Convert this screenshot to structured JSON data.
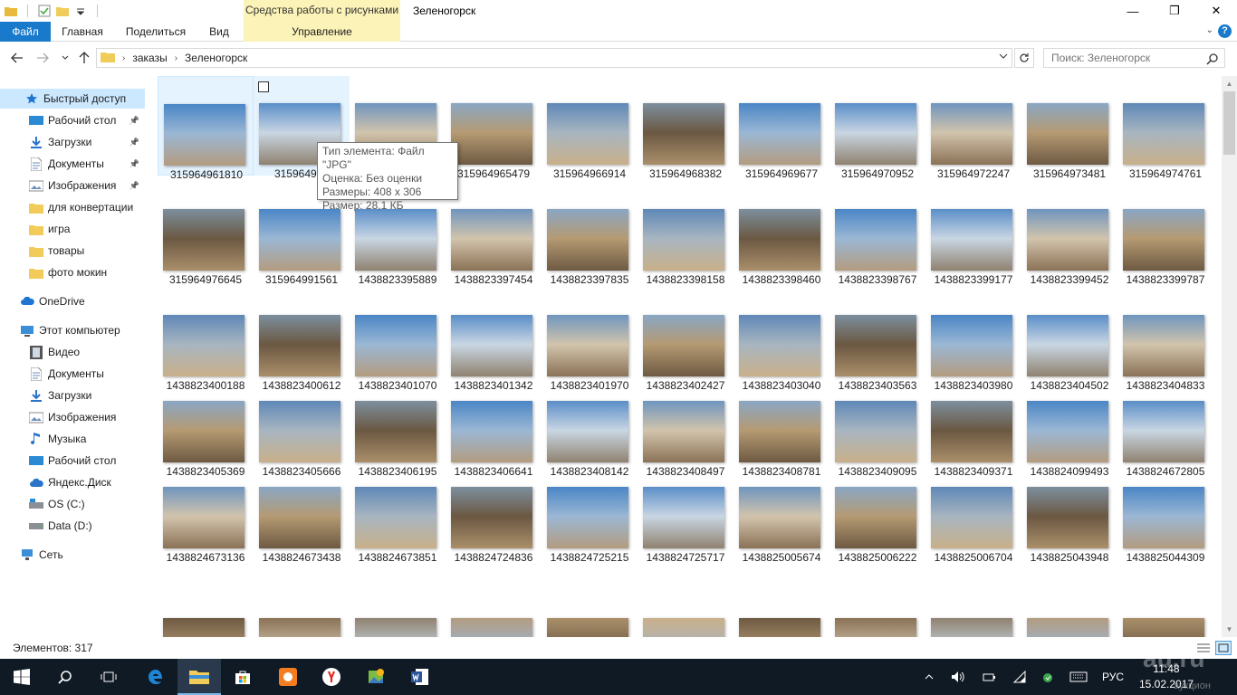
{
  "window": {
    "title": "Зеленогорск",
    "contextual_group": "Средства работы с рисунками",
    "minimize": "—",
    "maximize": "❐",
    "close": "✕"
  },
  "ribbon": {
    "tabs": [
      "Файл",
      "Главная",
      "Поделиться",
      "Вид"
    ],
    "contextual_tab": "Управление",
    "help": "?"
  },
  "address": {
    "crumbs": [
      "заказы",
      "Зеленогорск"
    ],
    "search_placeholder": "Поиск: Зеленогорск"
  },
  "nav": {
    "quick_access": "Быстрый доступ",
    "quick_items": [
      {
        "label": "Рабочий стол",
        "icon": "desktop-icon",
        "pinned": true
      },
      {
        "label": "Загрузки",
        "icon": "downloads-icon",
        "pinned": true
      },
      {
        "label": "Документы",
        "icon": "documents-icon",
        "pinned": true
      },
      {
        "label": "Изображения",
        "icon": "pictures-icon",
        "pinned": true
      },
      {
        "label": "для конвертации",
        "icon": "folder-icon",
        "pinned": false
      },
      {
        "label": "игра",
        "icon": "folder-icon",
        "pinned": false
      },
      {
        "label": "товары",
        "icon": "folder-icon",
        "pinned": false
      },
      {
        "label": "фото мокин",
        "icon": "folder-icon",
        "pinned": false
      }
    ],
    "onedrive": "OneDrive",
    "this_pc": "Этот компьютер",
    "pc_items": [
      {
        "label": "Видео",
        "icon": "video-icon"
      },
      {
        "label": "Документы",
        "icon": "documents-icon"
      },
      {
        "label": "Загрузки",
        "icon": "downloads-icon"
      },
      {
        "label": "Изображения",
        "icon": "pictures-icon"
      },
      {
        "label": "Музыка",
        "icon": "music-icon"
      },
      {
        "label": "Рабочий стол",
        "icon": "desktop-icon"
      },
      {
        "label": "Яндекс.Диск",
        "icon": "yandex-disk-icon"
      },
      {
        "label": "OS (C:)",
        "icon": "drive-c-icon"
      },
      {
        "label": "Data (D:)",
        "icon": "drive-d-icon"
      }
    ],
    "network": "Сеть"
  },
  "files": [
    "315964961810",
    "315964963",
    "315964965479_hidden",
    "315964965479",
    "315964966914",
    "315964968382",
    "315964969677",
    "315964970952",
    "315964972247",
    "315964973481",
    "315964974761",
    "315964976645",
    "315964991561",
    "1438823395889",
    "1438823397454",
    "1438823397835",
    "1438823398158",
    "1438823398460",
    "1438823398767",
    "1438823399177",
    "1438823399452",
    "1438823399787",
    "1438823400188",
    "1438823400612",
    "1438823401070",
    "1438823401342",
    "1438823401970",
    "1438823402427",
    "1438823403040",
    "1438823403563",
    "1438823403980",
    "1438823404502",
    "1438823404833",
    "1438823405369",
    "1438823405666",
    "1438823406195",
    "1438823406641",
    "1438823408142",
    "1438823408497",
    "1438823408781",
    "1438823409095",
    "1438823409371",
    "1438824099493",
    "1438824672805",
    "1438824673136",
    "1438824673438",
    "1438824673851",
    "1438824724836",
    "1438824725215",
    "1438824725717",
    "1438825005674",
    "1438825006222",
    "1438825006704",
    "1438825043948",
    "1438825044309"
  ],
  "tooltip": {
    "line1": "Тип элемента: Файл \"JPG\"",
    "line2": "Оценка: Без оценки",
    "line3": "Размеры: 408 x 306",
    "line4": "Размер: 28,1 КБ"
  },
  "status": {
    "count": "Элементов: 317"
  },
  "taskbar": {
    "lang": "РУС",
    "time": "11:48",
    "date": "15.02.2017"
  },
  "watermark": "au.ru",
  "watermark_sub": "аукцион"
}
